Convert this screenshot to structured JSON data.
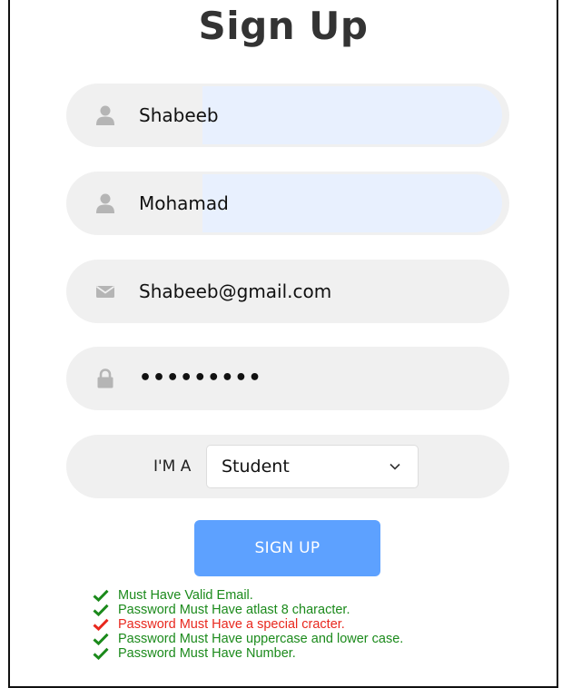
{
  "form": {
    "title": "Sign Up",
    "first_name": {
      "value": "Shabeeb",
      "icon": "user-icon"
    },
    "last_name": {
      "value": "Mohamad",
      "icon": "user-icon"
    },
    "email": {
      "value": "Shabeeb@gmail.com",
      "icon": "envelope-icon"
    },
    "password": {
      "value": "•••••••••",
      "icon": "lock-icon"
    },
    "role": {
      "label": "I'M A",
      "selected": "Student"
    },
    "submit_label": "SIGN UP"
  },
  "validation": [
    {
      "text": "Must Have Valid Email.",
      "status": "pass"
    },
    {
      "text": "Password Must Have atlast 8 character.",
      "status": "pass"
    },
    {
      "text": "Password Must Have a special cracter.",
      "status": "fail"
    },
    {
      "text": "Password Must Have uppercase and lower case.",
      "status": "pass"
    },
    {
      "text": "Password Must Have Number.",
      "status": "pass"
    }
  ],
  "colors": {
    "pass": "#1b8a1b",
    "fail": "#e8281e",
    "button": "#5da1ff",
    "field_bg": "#f0f0f0",
    "autofill_bg": "#e8f0fe"
  }
}
